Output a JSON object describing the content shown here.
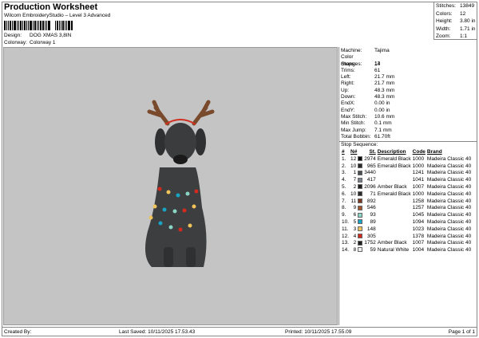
{
  "header": {
    "title": "Production Worksheet",
    "subtitle": "Wilcom EmbroideryStudio – Level 3 Advanced",
    "design_label": "Design:",
    "design": "DOG XMAS 3,8IN",
    "colorway_label": "Colorway:",
    "colorway": "Colorway 1"
  },
  "stats": [
    {
      "k": "Stitches:",
      "v": "13849"
    },
    {
      "k": "Colors:",
      "v": "12"
    },
    {
      "k": "Height:",
      "v": "3.80 in"
    },
    {
      "k": "Width:",
      "v": "1.71 in"
    },
    {
      "k": "Zoom:",
      "v": "1:1"
    }
  ],
  "info": [
    {
      "k": "Machine:",
      "v": "Tajima"
    },
    {
      "k": "Color changes:",
      "v": "13"
    },
    {
      "k": "Stops:",
      "v": "14"
    },
    {
      "k": "Trims:",
      "v": "61"
    },
    {
      "k": "Left:",
      "v": "21.7 mm"
    },
    {
      "k": "Right:",
      "v": "21.7 mm"
    },
    {
      "k": "Up:",
      "v": "48.3 mm"
    },
    {
      "k": "Down:",
      "v": "48.3 mm"
    },
    {
      "k": "EndX:",
      "v": "0.00 in"
    },
    {
      "k": "EndY:",
      "v": "0.00 in"
    },
    {
      "k": "Max Stitch:",
      "v": "10.6 mm"
    },
    {
      "k": "Min Stitch:",
      "v": "0.1 mm"
    },
    {
      "k": "Max Jump:",
      "v": "7.1 mm"
    },
    {
      "k": "Total Bobbin:",
      "v": "61.70ft"
    }
  ],
  "sequence": {
    "title": "Stop Sequence:",
    "columns": [
      "#",
      "N#",
      "St.",
      "Description",
      "Code",
      "Brand"
    ],
    "rows": [
      [
        "1.",
        "12",
        "#0a0a0a",
        "2974",
        "Emerald Black",
        "1000",
        "Madeira Classic 40"
      ],
      [
        "2.",
        "10",
        "#2a2a2a",
        "965",
        "Emerald Black",
        "1000",
        "Madeira Classic 40"
      ],
      [
        "3.",
        "1",
        "#4a4e52",
        "3440",
        "",
        "1241",
        "Madeira Classic 40"
      ],
      [
        "4.",
        "7",
        "#7a8088",
        "417",
        "",
        "1041",
        "Madeira Classic 40"
      ],
      [
        "5.",
        "2",
        "#1e1e1e",
        "2096",
        "Amber Black",
        "1007",
        "Madeira Classic 40"
      ],
      [
        "6.",
        "10",
        "#2a2a2a",
        "71",
        "Emerald Black",
        "1000",
        "Madeira Classic 40"
      ],
      [
        "7.",
        "11",
        "#7a3a22",
        "892",
        "",
        "1258",
        "Madeira Classic 40"
      ],
      [
        "8.",
        "9",
        "#a0562e",
        "546",
        "",
        "1257",
        "Madeira Classic 40"
      ],
      [
        "9.",
        "6",
        "#8ad4c4",
        "93",
        "",
        "1045",
        "Madeira Classic 40"
      ],
      [
        "10.",
        "5",
        "#18a4c4",
        "89",
        "",
        "1094",
        "Madeira Classic 40"
      ],
      [
        "11.",
        "3",
        "#f0c45a",
        "148",
        "",
        "1023",
        "Madeira Classic 40"
      ],
      [
        "12.",
        "4",
        "#d42a1e",
        "305",
        "",
        "1378",
        "Madeira Classic 40"
      ],
      [
        "13.",
        "2",
        "#1e1e1e",
        "1752",
        "Amber Black",
        "1007",
        "Madeira Classic 40"
      ],
      [
        "14.",
        "8",
        "#eeeeee",
        "59",
        "Natural White",
        "1004",
        "Madeira Classic 40"
      ]
    ]
  },
  "footer": {
    "created": "Created By:",
    "saved": "Last Saved: 10/11/2025 17.53.43",
    "printed": "Printed: 10/11/2025 17.55.09",
    "page": "Page 1 of 1"
  }
}
